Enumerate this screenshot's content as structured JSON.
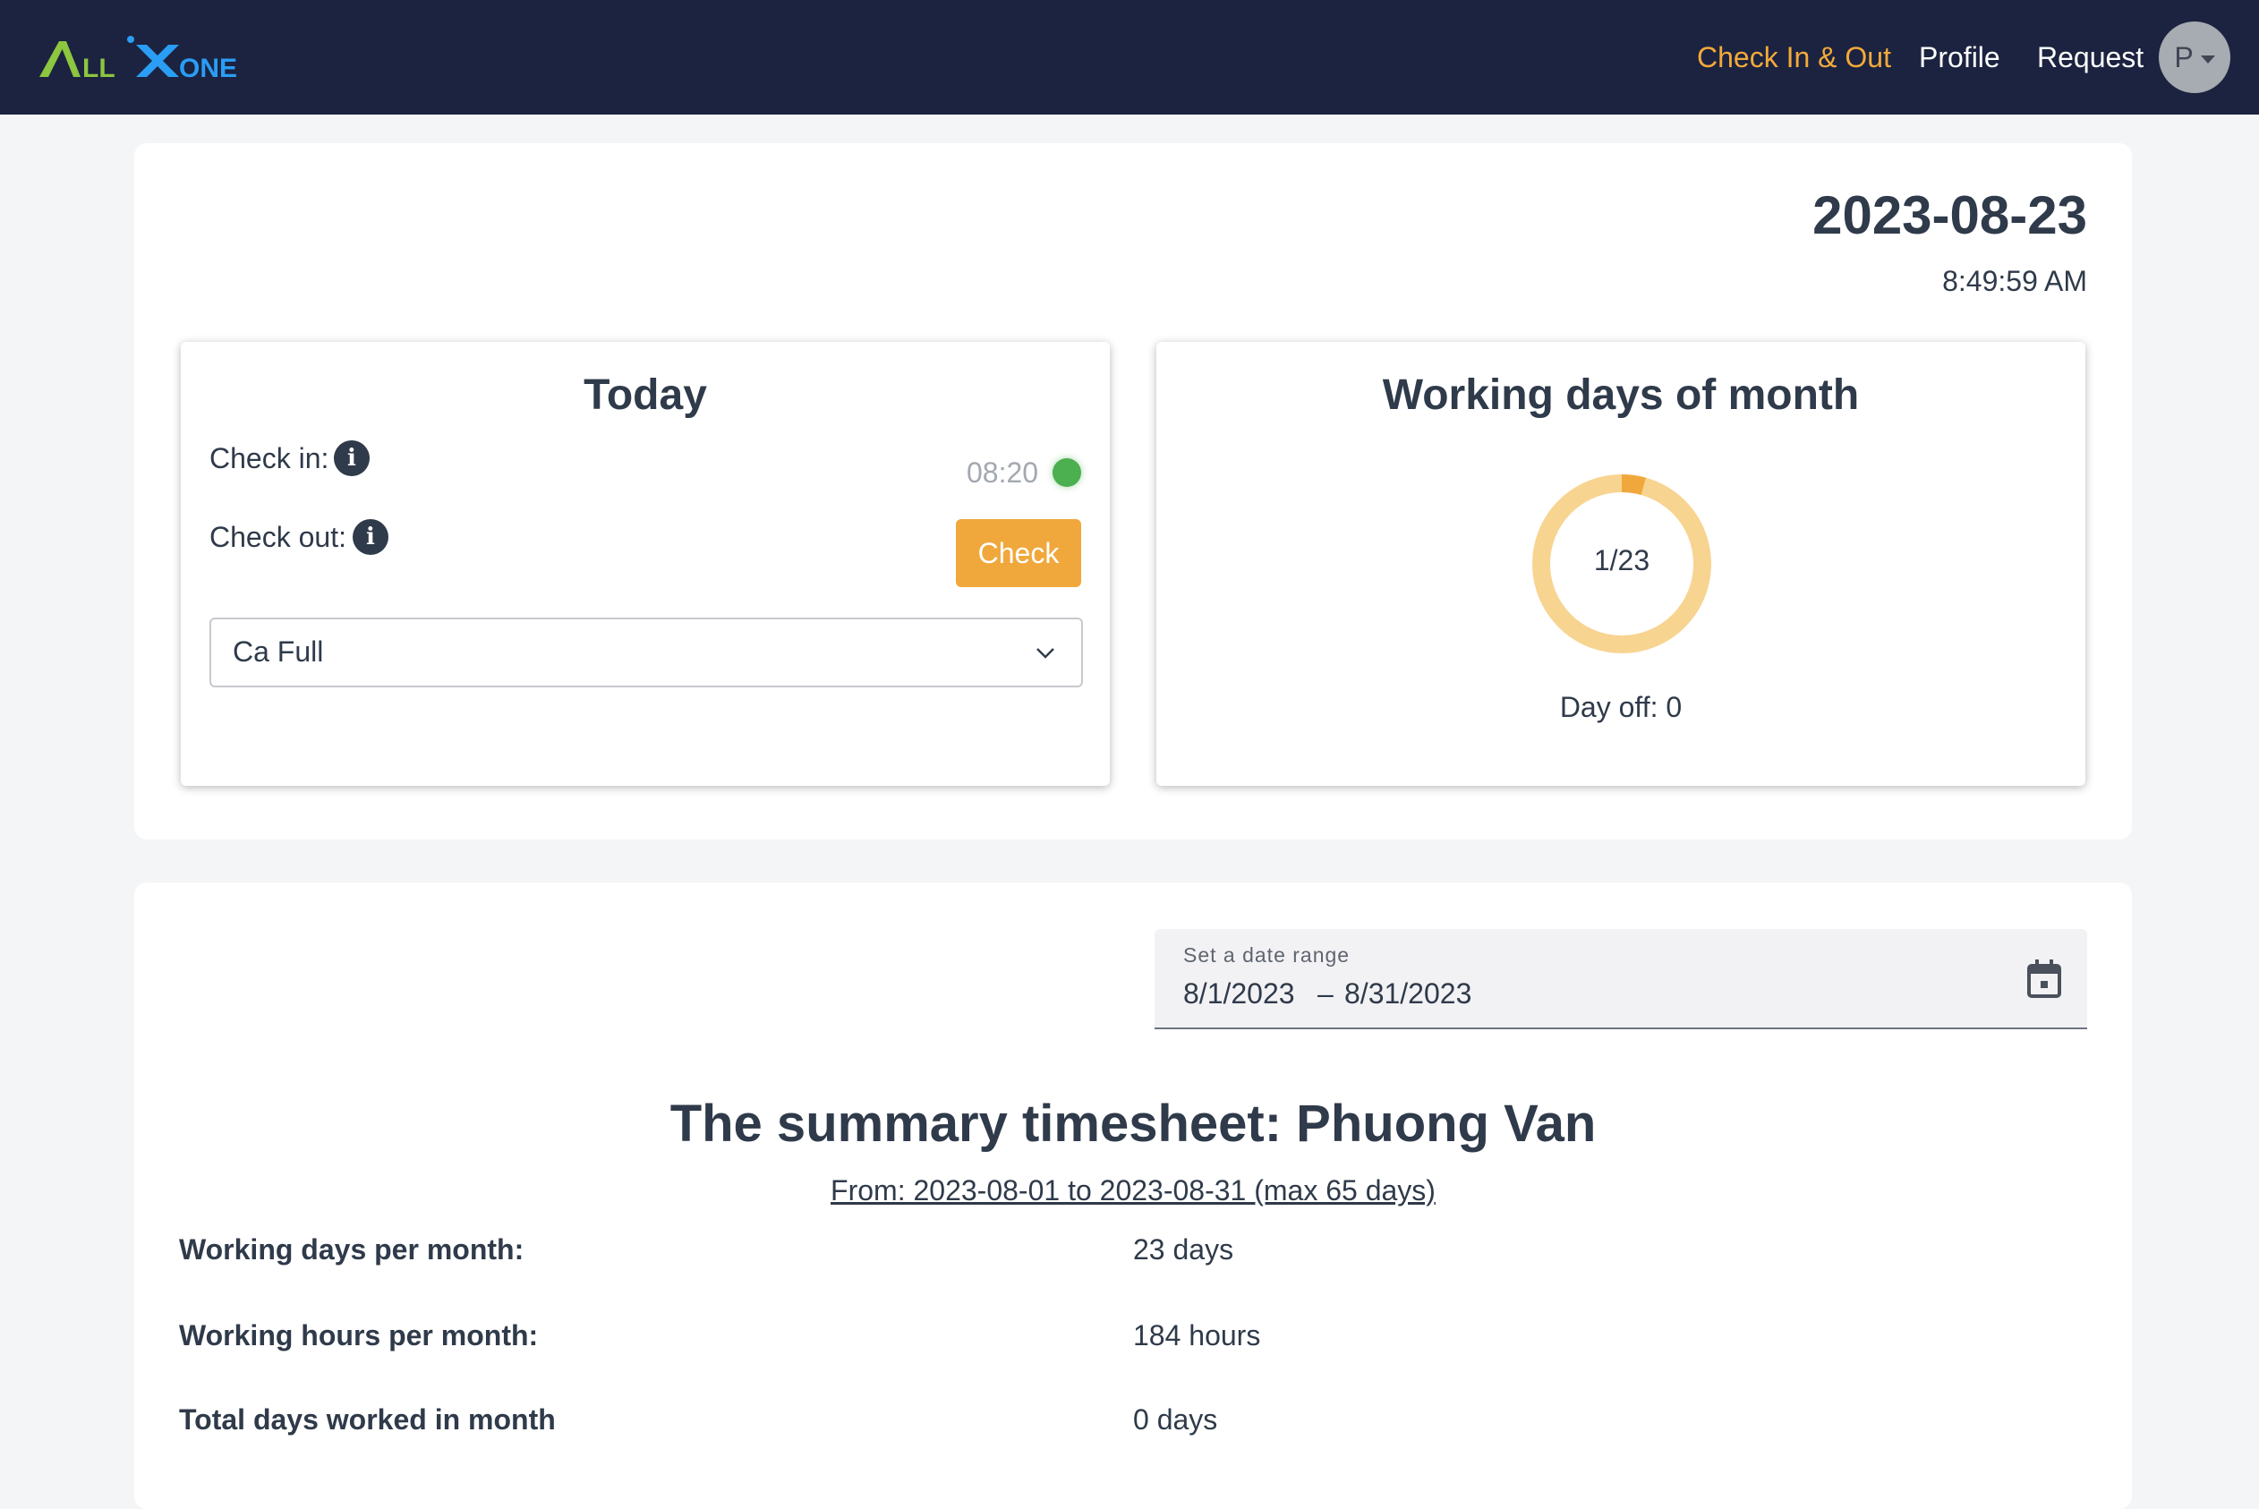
{
  "navbar": {
    "logo_text": "ALLXONE",
    "links": [
      "Check In & Out",
      "Profile",
      "Request"
    ],
    "avatar_initial": "P",
    "active_color": "#f4a93a",
    "background": "#1b2340"
  },
  "header": {
    "date": "2023-08-23",
    "time": "8:49:59 AM"
  },
  "today_card": {
    "title": "Today",
    "check_in_label": "Check in:",
    "check_out_label": "Check out:",
    "check_in_time": "08:20",
    "status_color": "#4caf50",
    "check_button": "Check",
    "shift_select": "Ca Full"
  },
  "working_days_card": {
    "title": "Working days of month",
    "progress_label": "1/23",
    "days_worked": 1,
    "days_total": 23,
    "day_off_text": "Day off: 0"
  },
  "date_range": {
    "label": "Set a date range",
    "start": "8/1/2023",
    "separator": "–",
    "end": "8/31/2023"
  },
  "summary": {
    "title": "The summary timesheet: Phuong Van",
    "subtitle": "From: 2023-08-01 to 2023-08-31 (max 65 days)",
    "rows": [
      {
        "label": "Working days per month:",
        "value": "23 days"
      },
      {
        "label": "Working hours per month:",
        "value": "184 hours"
      },
      {
        "label": "Total days worked in month",
        "value": "0 days"
      }
    ]
  }
}
